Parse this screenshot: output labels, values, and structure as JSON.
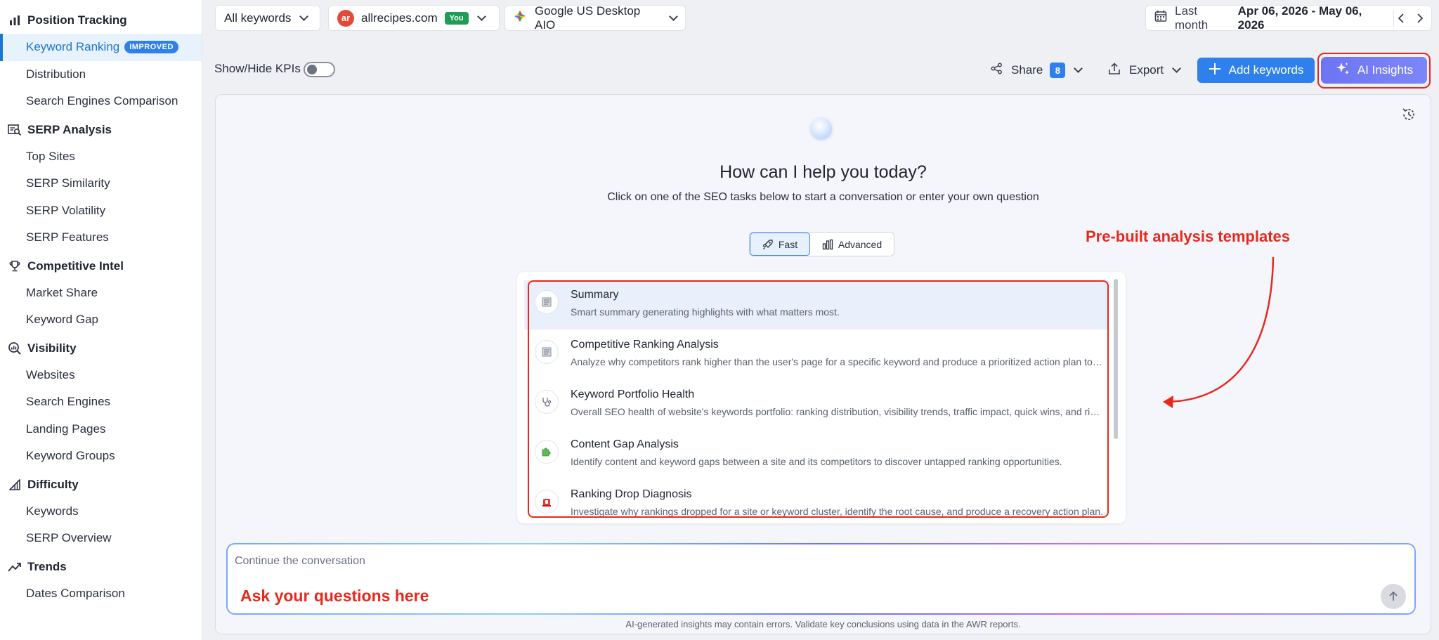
{
  "sidebar": {
    "sections": [
      {
        "title": "Position Tracking",
        "icon": "bar-chart-icon",
        "items": [
          {
            "label": "Keyword Ranking",
            "badge": "IMPROVED",
            "active": true
          },
          {
            "label": "Distribution"
          },
          {
            "label": "Search Engines Comparison"
          }
        ]
      },
      {
        "title": "SERP Analysis",
        "icon": "serp-search-icon",
        "items": [
          {
            "label": "Top Sites"
          },
          {
            "label": "SERP Similarity"
          },
          {
            "label": "SERP Volatility"
          },
          {
            "label": "SERP Features"
          }
        ]
      },
      {
        "title": "Competitive Intel",
        "icon": "trophy-icon",
        "items": [
          {
            "label": "Market Share"
          },
          {
            "label": "Keyword Gap"
          }
        ]
      },
      {
        "title": "Visibility",
        "icon": "visibility-search-icon",
        "items": [
          {
            "label": "Websites"
          },
          {
            "label": "Search Engines"
          },
          {
            "label": "Landing Pages"
          },
          {
            "label": "Keyword Groups"
          }
        ]
      },
      {
        "title": "Difficulty",
        "icon": "difficulty-icon",
        "items": [
          {
            "label": "Keywords"
          },
          {
            "label": "SERP Overview"
          }
        ]
      },
      {
        "title": "Trends",
        "icon": "trend-up-icon",
        "items": [
          {
            "label": "Dates Comparison"
          }
        ]
      }
    ]
  },
  "topbar": {
    "keywords_filter": "All keywords",
    "site": "allrecipes.com",
    "site_logo_text": "ar",
    "site_badge": "You",
    "engine": "Google US Desktop AIO",
    "period_label": "Last month",
    "date_range": "Apr 06, 2026 - May 06, 2026"
  },
  "toolbar": {
    "kpi_label": "Show/Hide KPIs",
    "share_label": "Share",
    "share_count": "8",
    "export_label": "Export",
    "add_keywords_label": "Add keywords",
    "ai_insights_label": "AI Insights"
  },
  "assistant": {
    "headline": "How can I help you today?",
    "subhead": "Click on one of the SEO tasks below to start a conversation or enter your own question",
    "modes": [
      "Fast",
      "Advanced"
    ],
    "templates": [
      {
        "title": "Summary",
        "desc": "Smart summary generating highlights with what matters most.",
        "icon": "document-icon"
      },
      {
        "title": "Competitive Ranking Analysis",
        "desc": "Analyze why competitors rank higher than the user's page for a specific keyword and produce a prioritized action plan to improve rankings.",
        "icon": "document-icon"
      },
      {
        "title": "Keyword Portfolio Health",
        "desc": "Overall SEO health of website's keywords portfolio: ranking distribution, visibility trends, traffic impact, quick wins, and risks.",
        "icon": "stethoscope-icon"
      },
      {
        "title": "Content Gap Analysis",
        "desc": "Identify content and keyword gaps between a site and its competitors to discover untapped ranking opportunities.",
        "icon": "puzzle-icon"
      },
      {
        "title": "Ranking Drop Diagnosis",
        "desc": "Investigate why rankings dropped for a site or keyword cluster, identify the root cause, and produce a recovery action plan.",
        "icon": "alarm-icon"
      }
    ],
    "input_placeholder": "Continue the conversation",
    "disclaimer": "AI-generated insights may contain errors. Validate key conclusions using data in the AWR reports."
  },
  "annotations": {
    "templates_note": "Pre-built analysis templates",
    "ask_note": "Ask your questions here"
  },
  "colors": {
    "accent": "#2f80ed",
    "ai_button": "#6c74f2",
    "annotation": "#e8281c",
    "you_badge": "#1f9d55"
  }
}
